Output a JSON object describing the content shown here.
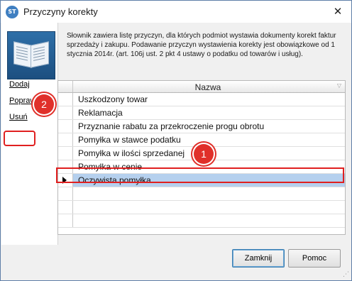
{
  "window": {
    "title": "Przyczyny korekty",
    "icon": "app-logo-icon",
    "icon_text": "ST",
    "close_glyph": "✕"
  },
  "description": "Słownik zawiera listę przyczyn, dla których podmiot wystawia dokumenty korekt faktur sprzedaży i zakupu. Podawanie przyczyn wystawienia korekty jest obowiązkowe od 1 stycznia 2014r. (art. 106j ust. 2 pkt 4 ustawy o podatku od towarów i usług).",
  "sidebar": {
    "actions": [
      {
        "label": "Dodaj"
      },
      {
        "label": "Popraw"
      },
      {
        "label": "Usuń"
      }
    ]
  },
  "grid": {
    "column_header": "Nazwa",
    "filter_glyph": "▽",
    "rows": [
      "Uszkodzony towar",
      "Reklamacja",
      "Przyznanie rabatu za przekroczenie progu obrotu",
      "Pomyłka w stawce podatku",
      "Pomyłka w ilości sprzedanej",
      "Pomyłka w cenie",
      "Oczywista pomyłka"
    ],
    "selected_row": "Oczywista pomyłka"
  },
  "buttons": {
    "close_label": "Zamknij",
    "help_label": "Pomoc"
  },
  "annotations": {
    "badge_1": "1",
    "badge_2": "2",
    "color": "#e0302a"
  }
}
